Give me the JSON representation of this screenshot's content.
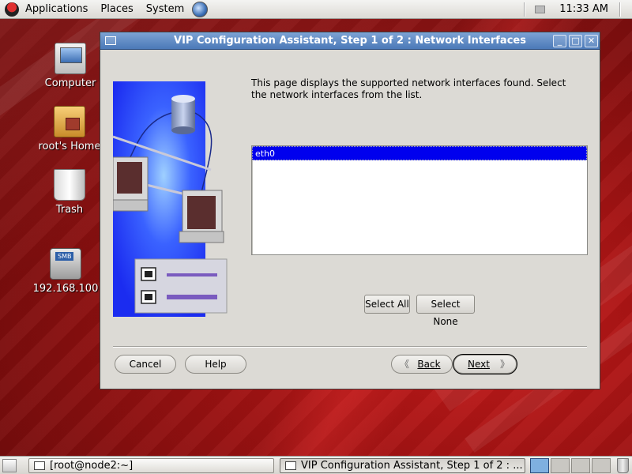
{
  "top_panel": {
    "menus": [
      "Applications",
      "Places",
      "System"
    ],
    "clock": "11:33 AM"
  },
  "desktop_icons": [
    {
      "label": "Computer",
      "icon": "computer-icon"
    },
    {
      "label": "root's Home",
      "icon": "home-folder-icon"
    },
    {
      "label": "Trash",
      "icon": "trash-icon"
    },
    {
      "label": "192.168.100",
      "icon": "smb-share-icon",
      "badge": "SMB"
    }
  ],
  "dialog": {
    "title": "VIP Configuration Assistant, Step 1 of 2 : Network Interfaces",
    "description": "This page displays the supported network interfaces found. Select the network interfaces from the list.",
    "interfaces": [
      {
        "name": "eth0",
        "selected": true
      }
    ],
    "select_all_label": "Select All",
    "select_none_label": "Select None",
    "cancel_label": "Cancel",
    "help_label": "Help",
    "back_label": "Back",
    "next_label": "Next"
  },
  "taskbar": {
    "tasks": [
      {
        "label": "[root@node2:~]",
        "active": false
      },
      {
        "label": "VIP Configuration Assistant, Step 1 of 2 : ...",
        "active": true
      }
    ],
    "workspaces": 4,
    "active_workspace": 1
  },
  "colors": {
    "titlebar": "#4b79b8",
    "selection": "#0000ee",
    "desktop": "#9d1212"
  }
}
